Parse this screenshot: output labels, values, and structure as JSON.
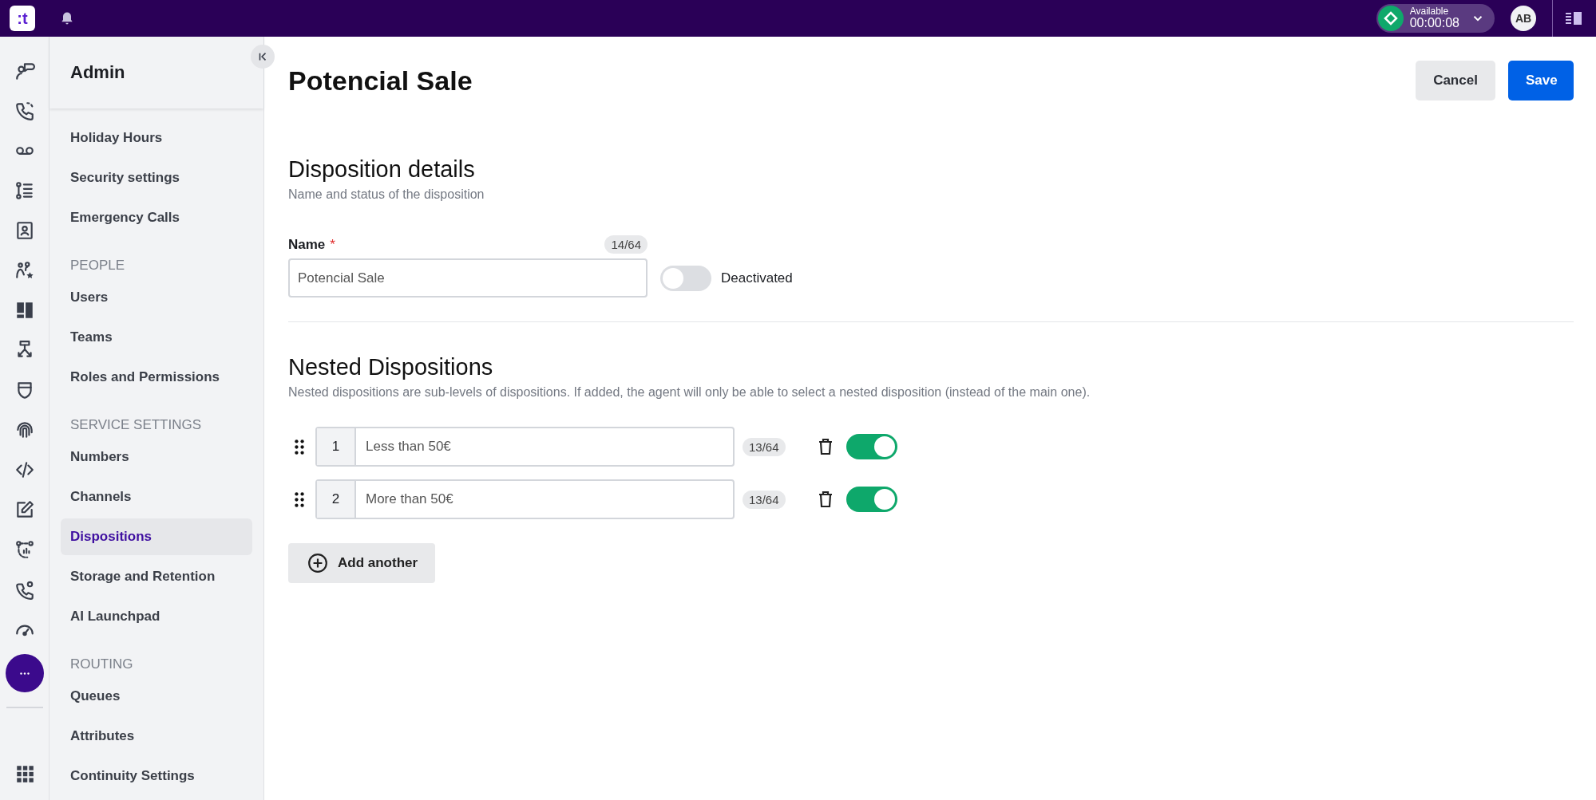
{
  "top_bar": {
    "logo": ":t",
    "status": {
      "label": "Available",
      "timer": "00:00:08"
    },
    "avatar": "AB"
  },
  "sidebar": {
    "title": "Admin",
    "sections": [
      {
        "items": [
          {
            "label": "Holiday Hours",
            "selected": false
          },
          {
            "label": "Security settings",
            "selected": false
          },
          {
            "label": "Emergency Calls",
            "selected": false
          }
        ]
      },
      {
        "heading": "PEOPLE",
        "items": [
          {
            "label": "Users",
            "selected": false
          },
          {
            "label": "Teams",
            "selected": false
          },
          {
            "label": "Roles and Permissions",
            "selected": false
          }
        ]
      },
      {
        "heading": "SERVICE SETTINGS",
        "items": [
          {
            "label": "Numbers",
            "selected": false
          },
          {
            "label": "Channels",
            "selected": false
          },
          {
            "label": "Dispositions",
            "selected": true
          },
          {
            "label": "Storage and Retention",
            "selected": false
          },
          {
            "label": "AI Launchpad",
            "selected": false
          }
        ]
      },
      {
        "heading": "ROUTING",
        "items": [
          {
            "label": "Queues",
            "selected": false
          },
          {
            "label": "Attributes",
            "selected": false
          },
          {
            "label": "Continuity Settings",
            "selected": false
          }
        ]
      }
    ]
  },
  "page": {
    "title": "Potencial Sale",
    "actions": [
      {
        "label": "Cancel",
        "kind": "secondary"
      },
      {
        "label": "Save",
        "kind": "primary"
      }
    ]
  },
  "details": {
    "heading": "Disposition details",
    "description": "Name and status of the disposition",
    "name_field": {
      "label": "Name",
      "required_mark": "*",
      "counter": "14/64",
      "value": "Potencial Sale"
    },
    "status_toggle": {
      "on": false,
      "label": "Deactivated"
    }
  },
  "nested": {
    "heading": "Nested Dispositions",
    "description": "Nested dispositions are sub-levels of dispositions. If added, the agent will only be able to select a nested disposition (instead of the main one).",
    "items": [
      {
        "number": "1",
        "value": "Less than 50€",
        "counter": "13/64",
        "on": true
      },
      {
        "number": "2",
        "value": "More than 50€",
        "counter": "13/64",
        "on": true
      }
    ],
    "add_button": "Add another"
  }
}
